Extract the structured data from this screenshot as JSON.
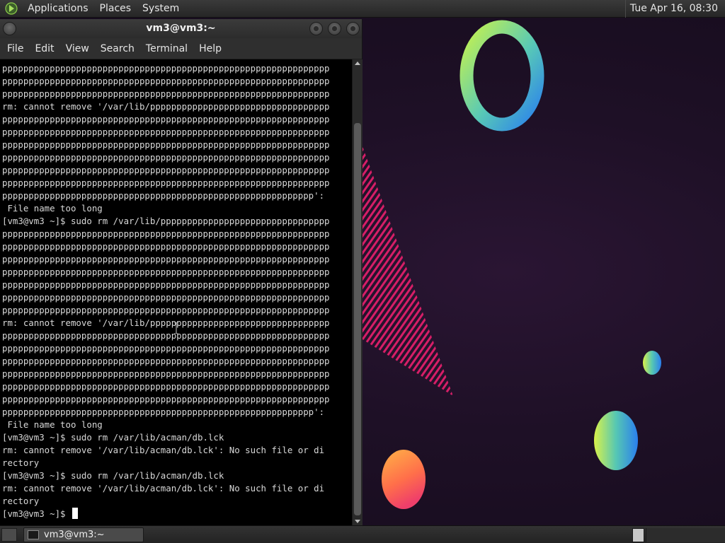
{
  "top_panel": {
    "menus": [
      "Applications",
      "Places",
      "System"
    ],
    "clock": "Tue Apr 16, 08:30"
  },
  "window": {
    "title": "vm3@vm3:~",
    "menus": [
      "File",
      "Edit",
      "View",
      "Search",
      "Terminal",
      "Help"
    ]
  },
  "terminal": {
    "lines": [
      "pppppppppppppppppppppppppppppppppppppppppppppppppppppppppppppp",
      "pppppppppppppppppppppppppppppppppppppppppppppppppppppppppppppp",
      "pppppppppppppppppppppppppppppppppppppppppppppppppppppppppppppp",
      "rm: cannot remove '/var/lib/pppppppppppppppppppppppppppppppppp",
      "pppppppppppppppppppppppppppppppppppppppppppppppppppppppppppppp",
      "pppppppppppppppppppppppppppppppppppppppppppppppppppppppppppppp",
      "pppppppppppppppppppppppppppppppppppppppppppppppppppppppppppppp",
      "pppppppppppppppppppppppppppppppppppppppppppppppppppppppppppppp",
      "pppppppppppppppppppppppppppppppppppppppppppppppppppppppppppppp",
      "pppppppppppppppppppppppppppppppppppppppppppppppppppppppppppppp",
      "ppppppppppppppppppppppppppppppppppppppppppppppppppppppppppp':",
      " File name too long",
      "[vm3@vm3 ~]$ sudo rm /var/lib/pppppppppppppppppppppppppppppppp",
      "pppppppppppppppppppppppppppppppppppppppppppppppppppppppppppppp",
      "pppppppppppppppppppppppppppppppppppppppppppppppppppppppppppppp",
      "pppppppppppppppppppppppppppppppppppppppppppppppppppppppppppppp",
      "pppppppppppppppppppppppppppppppppppppppppppppppppppppppppppppp",
      "pppppppppppppppppppppppppppppppppppppppppppppppppppppppppppppp",
      "pppppppppppppppppppppppppppppppppppppppppppppppppppppppppppppp",
      "pppppppppppppppppppppppppppppppppppppppppppppppppppppppppppppp",
      "rm: cannot remove '/var/lib/pppppppppppppppppppppppppppppppppp",
      "pppppppppppppppppppppppppppppppppppppppppppppppppppppppppppppp",
      "pppppppppppppppppppppppppppppppppppppppppppppppppppppppppppppp",
      "pppppppppppppppppppppppppppppppppppppppppppppppppppppppppppppp",
      "pppppppppppppppppppppppppppppppppppppppppppppppppppppppppppppp",
      "pppppppppppppppppppppppppppppppppppppppppppppppppppppppppppppp",
      "pppppppppppppppppppppppppppppppppppppppppppppppppppppppppppppp",
      "ppppppppppppppppppppppppppppppppppppppppppppppppppppppppppp':",
      " File name too long",
      "[vm3@vm3 ~]$ sudo rm /var/lib/acman/db.lck",
      "rm: cannot remove '/var/lib/acman/db.lck': No such file or di",
      "rectory",
      "[vm3@vm3 ~]$ sudo rm /var/lib/acman/db.lck",
      "rm: cannot remove '/var/lib/acman/db.lck': No such file or di",
      "rectory"
    ],
    "prompt": "[vm3@vm3 ~]$ "
  },
  "taskbar": {
    "task_label": "vm3@vm3:~"
  },
  "colors": {
    "accent_pink": "#e8246a",
    "ring_green": "#b5ef5a",
    "ring_blue": "#2f8fe6",
    "ball_orange": "#ff8a3d"
  }
}
